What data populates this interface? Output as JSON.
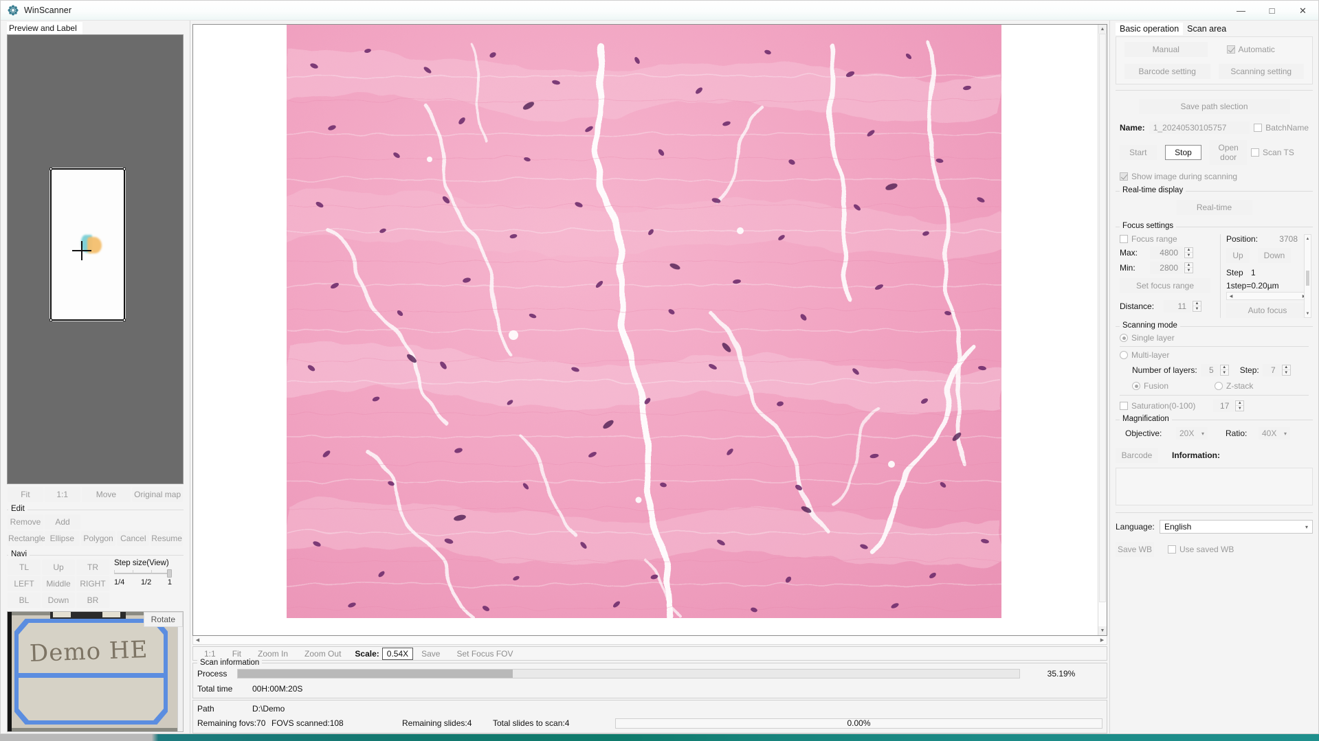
{
  "window": {
    "title": "WinScanner",
    "app_icon": "flower-gear-icon",
    "minimize": "—",
    "maximize": "□",
    "close": "✕"
  },
  "left_panel": {
    "tab_label": "Preview and Label",
    "view_buttons": [
      "Fit",
      "1:1",
      "Move",
      "Original map"
    ],
    "edit": {
      "title": "Edit",
      "row1": [
        "Remove",
        "Add"
      ],
      "row2": [
        "Rectangle",
        "Ellipse",
        "Polygon",
        "Cancel",
        "Resume"
      ]
    },
    "navi": {
      "title": "Navi",
      "grid": [
        "TL",
        "Up",
        "TR",
        "LEFT",
        "Middle",
        "RIGHT",
        "BL",
        "Down",
        "BR"
      ],
      "step_size_label": "Step size(View)",
      "step_ticks": [
        "1/4",
        "1/2",
        "1"
      ]
    },
    "label_photo": {
      "handwriting": "Demo HE",
      "rotate_label": "Rotate"
    }
  },
  "center": {
    "toolbar": {
      "one_to_one": "1:1",
      "fit": "Fit",
      "zoom_in": "Zoom In",
      "zoom_out": "Zoom Out",
      "scale_label": "Scale:",
      "scale_value": "0.54X",
      "save": "Save",
      "set_focus_fov": "Set Focus FOV"
    },
    "scan_information": {
      "title": "Scan information",
      "process_label": "Process",
      "process_percent": "35.19%",
      "process_value": 35.19,
      "total_time_label": "Total time",
      "total_time_value": "00H:00M:20S"
    },
    "path_block": {
      "path_label": "Path",
      "path_value": "D:\\Demo",
      "remaining_fovs": "Remaining fovs:70",
      "fovs_scanned": "FOVS scanned:108",
      "remaining_slides": "Remaining slides:4",
      "total_slides": "Total slides to scan:4",
      "slide_progress_percent": "0.00%",
      "slide_progress_value": 0.0
    }
  },
  "right_panel": {
    "tabs": [
      {
        "label": "Basic operation",
        "active": true
      },
      {
        "label": "Scan area",
        "active": false
      }
    ],
    "mode": {
      "manual": "Manual",
      "automatic": "Automatic",
      "automatic_checked": true,
      "barcode_setting": "Barcode setting",
      "scanning_setting": "Scanning setting"
    },
    "save_path_button": "Save path slection",
    "name": {
      "label": "Name:",
      "value": "1_20240530105757",
      "batch_name_label": "BatchName",
      "batch_name_checked": false
    },
    "actions": {
      "start": "Start",
      "stop": "Stop",
      "open_door": "Open door",
      "scan_ts_label": "Scan TS",
      "scan_ts_checked": false
    },
    "show_image": {
      "label": "Show image during scanning",
      "checked": true
    },
    "realtime": {
      "title": "Real-time display",
      "button": "Real-time"
    },
    "focus": {
      "title": "Focus settings",
      "focus_range_label": "Focus range",
      "focus_range_checked": false,
      "max_label": "Max:",
      "max_value": "4800",
      "min_label": "Min:",
      "min_value": "2800",
      "set_focus_range": "Set focus range",
      "distance_label": "Distance:",
      "distance_value": "11",
      "position_label": "Position:",
      "position_value": "3708",
      "up": "Up",
      "down": "Down",
      "step_label": "Step",
      "step_value": "1",
      "step_units": "1step=0.20µm",
      "auto_focus": "Auto focus"
    },
    "scanning_mode": {
      "title": "Scanning mode",
      "single_layer": "Single layer",
      "single_layer_selected": true,
      "multi_layer": "Multi-layer",
      "multi_layer_selected": false,
      "num_layers_label": "Number of layers:",
      "num_layers_value": "5",
      "step_label": "Step:",
      "step_value": "7",
      "fusion": "Fusion",
      "fusion_selected": true,
      "z_stack": "Z-stack",
      "z_stack_selected": false,
      "saturation_label": "Saturation(0-100)",
      "saturation_checked": false,
      "saturation_value": "17"
    },
    "magnification": {
      "title": "Magnification",
      "objective_label": "Objective:",
      "objective_value": "20X",
      "ratio_label": "Ratio:",
      "ratio_value": "40X"
    },
    "barcode": {
      "button": "Barcode",
      "information_label": "Information:",
      "information_value": ""
    },
    "language": {
      "label": "Language:",
      "value": "English"
    },
    "white_balance": {
      "save_wb": "Save WB",
      "use_saved_wb_label": "Use saved WB",
      "use_saved_wb_checked": false
    }
  },
  "colors": {
    "accent_teal": "#1f8f8c",
    "stain_pink": "#f2a6c4",
    "nuclei_purple": "#6e2a6b",
    "panel_bg": "#f4f4f4",
    "label_blue": "#5b8de0"
  }
}
